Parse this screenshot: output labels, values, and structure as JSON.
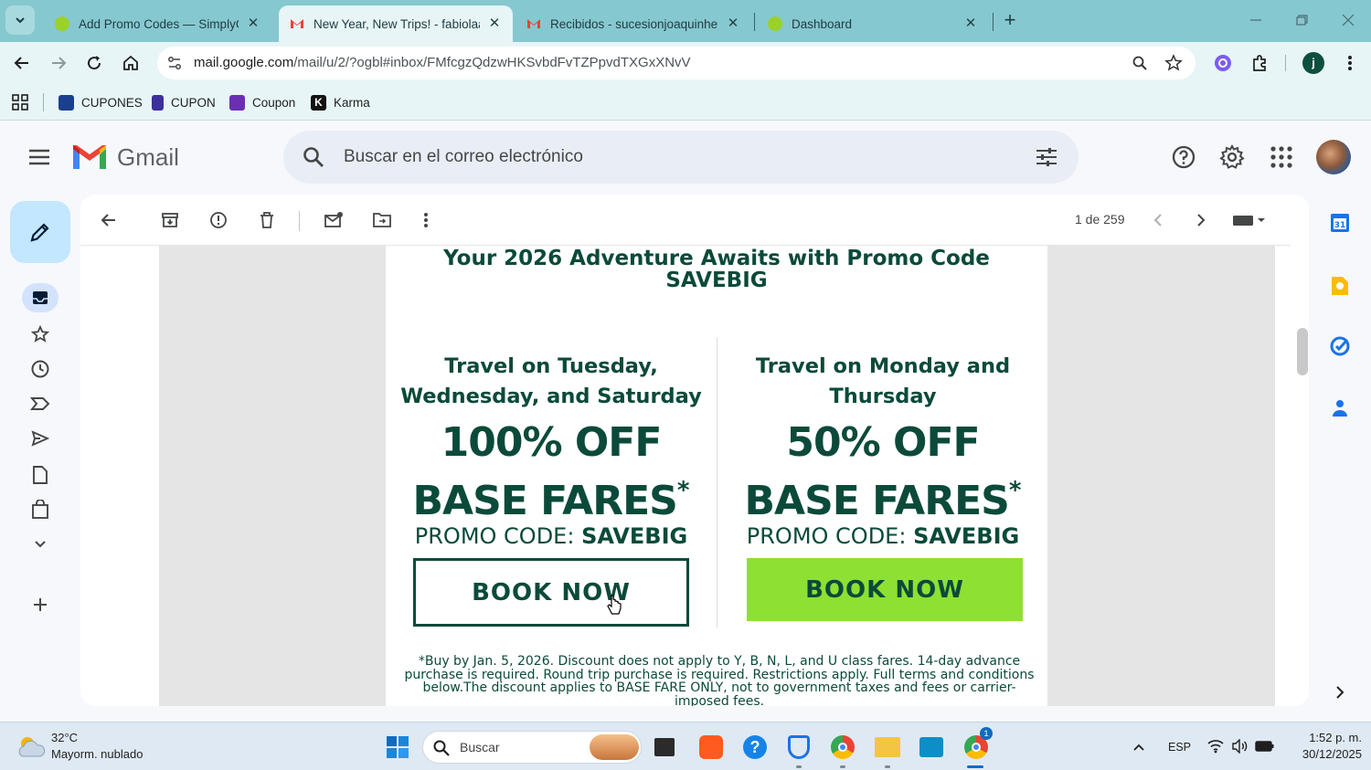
{
  "tabs": [
    {
      "title": "Add Promo Codes — SimplyCo",
      "active": false
    },
    {
      "title": "New Year, New Trips! - fabiolaa",
      "active": true
    },
    {
      "title": "Recibidos - sucesionjoaquinher",
      "active": false
    },
    {
      "title": "Dashboard",
      "active": false
    }
  ],
  "browser": {
    "url_host": "mail.google.com",
    "url_path": "/mail/u/2/?ogbl#inbox/FMfcgzQdzwHKSvbdFvTZPpvdTXGxXNvV",
    "profile_initial": "j"
  },
  "bookmarks": [
    {
      "label": "CUPONES",
      "icon": "cupones-icon",
      "color": "#1b3f8f"
    },
    {
      "label": "CUPON",
      "icon": "lock-bag-icon",
      "color": "#3c2f9e"
    },
    {
      "label": "Coupon",
      "icon": "coupon-k-icon",
      "color": "#6b2fb3"
    },
    {
      "label": "Karma",
      "icon": "karma-k-icon",
      "color": "#111111"
    }
  ],
  "gmail": {
    "logo_text": "Gmail",
    "search_placeholder": "Buscar en el correo electrónico",
    "pagination": "1 de 259"
  },
  "email": {
    "headline_line1": "Your 2026 Adventure Awaits with Promo Code",
    "headline_line2": "SAVEBIG",
    "left": {
      "travel_line1": "Travel on Tuesday,",
      "travel_line2": "Wednesday, and Saturday",
      "off_line1": "100% OFF",
      "off_line2": "BASE FARES",
      "asterisk": "*",
      "code_label": "PROMO CODE:",
      "code_value": "SAVEBIG",
      "button": "BOOK NOW"
    },
    "right": {
      "travel_line1": "Travel on Monday and",
      "travel_line2": "Thursday",
      "off_line1": "50% OFF",
      "off_line2": "BASE FARES",
      "asterisk": "*",
      "code_label": "PROMO CODE:",
      "code_value": "SAVEBIG",
      "button": "BOOK NOW"
    },
    "fineprint": "*Buy by Jan. 5, 2026. Discount does not apply to Y, B, N, L, and U class fares. 14-day advance purchase is required. Round trip purchase is required. Restrictions apply. Full terms and conditions below.The discount applies to BASE FARE ONLY, not to government taxes and fees or carrier-imposed fees."
  },
  "taskbar": {
    "weather_temp": "32°C",
    "weather_desc": "Mayorm. nublado",
    "search_placeholder": "Buscar",
    "language": "ESP",
    "time": "1:52 p. m.",
    "date": "30/12/2025",
    "chrome_badge": "1"
  },
  "colors": {
    "tab_bar": "#86c8d0",
    "toolbar": "#e7f5f6",
    "brand_green": "#0b4a3a",
    "button_green": "#8ee032"
  }
}
